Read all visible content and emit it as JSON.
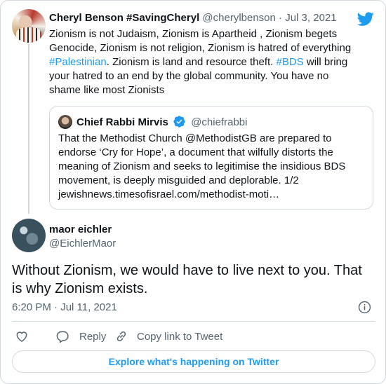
{
  "parent_tweet": {
    "name": "Cheryl Benson #SavingCheryl",
    "handle": "@cherylbenson",
    "separator": "·",
    "date": "Jul 3, 2021",
    "text_1": "Zionism is not Judaism, Zionism is Apartheid , Zionism begets Genocide, Zionism is not religion, Zionism is hatred of everything ",
    "hashtag_1": "#Palestinian",
    "text_2": ". Zionism is land and resource theft. ",
    "hashtag_2": "#BDS",
    "text_3": " will bring your hatred to an end by the global community. You have no shame like most Zionists"
  },
  "quoted_tweet": {
    "name": "Chief Rabbi Mirvis",
    "handle": "@chiefrabbi",
    "text": "That the Methodist Church @MethodistGB are prepared to endorse ‘Cry for Hope’, a document that wilfully distorts the meaning of Zionism and seeks to legitimise the insidious BDS movement, is deeply misguided and deplorable. 1/2 jewishnews.timesofisrael.com/methodist-moti…"
  },
  "main_tweet": {
    "name": "maor eichler",
    "handle": "@EichlerMaor",
    "text": "Without Zionism, we would have to live next to you. That is why Zionism exists.",
    "timestamp": "6:20 PM · Jul 11, 2021"
  },
  "actions": {
    "reply_label": "Reply",
    "copy_label": "Copy link to Tweet"
  },
  "explore_label": "Explore what's happening on Twitter",
  "colors": {
    "accent": "#1d9bf0",
    "text": "#0f1419",
    "muted": "#536471",
    "border": "#cfd9de"
  },
  "icons": [
    "twitter-logo-icon",
    "verified-badge-icon",
    "info-icon",
    "heart-icon",
    "reply-icon",
    "link-icon"
  ]
}
